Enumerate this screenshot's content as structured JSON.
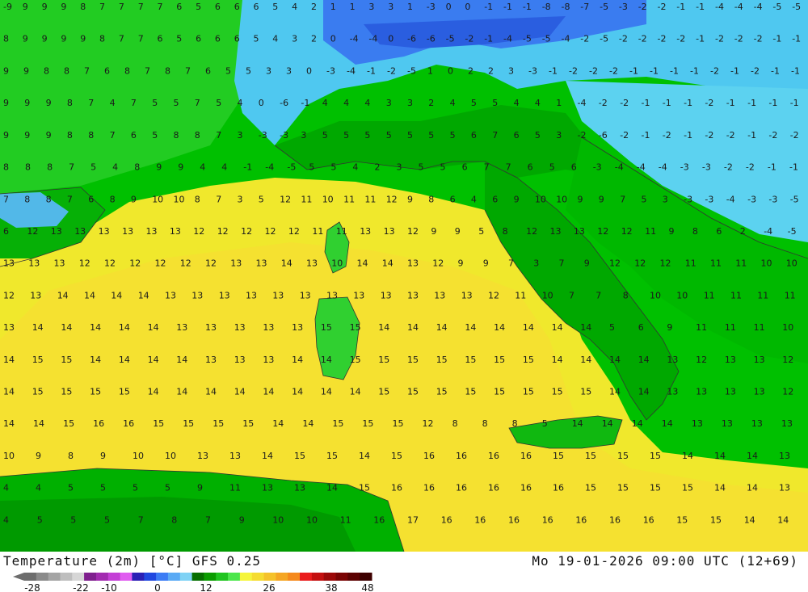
{
  "map": {
    "title": "Temperature (2m) [°C] GFS 0.25",
    "datetime": "Mo 19-01-2026 09:00 UTC (12+69)",
    "variable": "Temperature (2m)",
    "unit": "°C",
    "model": "GFS 0.25",
    "region": "Italy / Central Mediterranean",
    "value_rows": [
      [
        -9,
        9,
        9,
        9,
        8,
        7,
        7,
        7,
        7,
        6,
        5,
        6,
        6,
        6,
        5,
        4,
        2,
        1,
        1,
        3,
        3,
        1,
        -3,
        0,
        0,
        -1,
        -1,
        -1,
        -8,
        -8,
        -7,
        -5,
        -3,
        -2,
        -2,
        -1,
        -1,
        -4,
        -4,
        -4,
        -5,
        -5
      ],
      [
        8,
        9,
        9,
        9,
        9,
        8,
        7,
        7,
        6,
        5,
        6,
        6,
        6,
        5,
        4,
        3,
        2,
        0,
        -4,
        -4,
        0,
        -6,
        -6,
        -5,
        -2,
        -1,
        -4,
        -5,
        -5,
        -4,
        -2,
        -5,
        -2,
        -2,
        -2,
        -2,
        -1,
        -2,
        -2,
        -2,
        -1,
        -1
      ],
      [
        9,
        9,
        8,
        8,
        7,
        6,
        8,
        7,
        8,
        7,
        6,
        5,
        5,
        3,
        3,
        0,
        -3,
        -4,
        -1,
        -2,
        -5,
        1,
        0,
        2,
        2,
        3,
        -3,
        -1,
        -2,
        -2,
        -2,
        -1,
        -1,
        -1,
        -1,
        -2,
        -1,
        -2,
        -1,
        -1
      ],
      [
        9,
        9,
        9,
        8,
        7,
        4,
        7,
        5,
        5,
        7,
        5,
        4,
        0,
        -6,
        -1,
        4,
        4,
        4,
        3,
        3,
        2,
        4,
        5,
        5,
        4,
        4,
        1,
        -4,
        -2,
        -2,
        -1,
        -1,
        -1,
        -2,
        -1,
        -1,
        -1,
        -1
      ],
      [
        9,
        9,
        9,
        8,
        8,
        7,
        6,
        5,
        8,
        8,
        7,
        3,
        -3,
        -3,
        3,
        5,
        5,
        5,
        5,
        5,
        5,
        5,
        6,
        7,
        6,
        5,
        3,
        -2,
        -6,
        -2,
        -1,
        -2,
        -1,
        -2,
        -2,
        -1,
        -2,
        -2
      ],
      [
        8,
        8,
        8,
        7,
        5,
        4,
        8,
        9,
        9,
        4,
        4,
        -1,
        -4,
        -5,
        5,
        5,
        4,
        2,
        3,
        5,
        5,
        6,
        7,
        7,
        6,
        5,
        6,
        -3,
        -4,
        -4,
        -4,
        -3,
        -3,
        -2,
        -2,
        -1,
        -1
      ],
      [
        7,
        8,
        8,
        7,
        6,
        8,
        9,
        10,
        10,
        8,
        7,
        3,
        5,
        12,
        11,
        10,
        11,
        11,
        12,
        9,
        8,
        6,
        4,
        6,
        9,
        10,
        10,
        9,
        9,
        7,
        5,
        3,
        -3,
        -3,
        -4,
        -3,
        -3,
        -5
      ],
      [
        6,
        12,
        13,
        13,
        13,
        13,
        13,
        13,
        12,
        12,
        12,
        12,
        12,
        11,
        11,
        13,
        13,
        12,
        9,
        9,
        5,
        8,
        12,
        13,
        13,
        12,
        12,
        11,
        9,
        8,
        6,
        2,
        -4,
        -5
      ],
      [
        13,
        13,
        13,
        12,
        12,
        12,
        12,
        12,
        12,
        13,
        13,
        14,
        13,
        10,
        14,
        14,
        13,
        12,
        9,
        9,
        7,
        3,
        7,
        9,
        12,
        12,
        12,
        11,
        11,
        11,
        10,
        10
      ],
      [
        12,
        13,
        14,
        14,
        14,
        14,
        13,
        13,
        13,
        13,
        13,
        13,
        13,
        13,
        13,
        13,
        13,
        13,
        12,
        11,
        10,
        7,
        7,
        8,
        10,
        10,
        11,
        11,
        11,
        11
      ],
      [
        13,
        14,
        14,
        14,
        14,
        14,
        13,
        13,
        13,
        13,
        13,
        15,
        15,
        14,
        14,
        14,
        14,
        14,
        14,
        14,
        14,
        5,
        6,
        9,
        11,
        11,
        11,
        10
      ],
      [
        14,
        15,
        15,
        14,
        14,
        14,
        14,
        13,
        13,
        13,
        14,
        14,
        15,
        15,
        15,
        15,
        15,
        15,
        15,
        14,
        14,
        14,
        14,
        13,
        12,
        13,
        13,
        12
      ],
      [
        14,
        15,
        15,
        15,
        15,
        14,
        14,
        14,
        14,
        14,
        14,
        14,
        14,
        15,
        15,
        15,
        15,
        15,
        15,
        15,
        15,
        14,
        14,
        13,
        13,
        13,
        13,
        12
      ],
      [
        14,
        14,
        15,
        16,
        16,
        15,
        15,
        15,
        15,
        14,
        14,
        15,
        15,
        15,
        12,
        8,
        8,
        8,
        5,
        14,
        14,
        14,
        14,
        13,
        13,
        13,
        13
      ],
      [
        10,
        9,
        8,
        9,
        10,
        10,
        13,
        13,
        14,
        15,
        15,
        14,
        15,
        16,
        16,
        16,
        16,
        15,
        15,
        15,
        15,
        14,
        14,
        14,
        13
      ],
      [
        4,
        4,
        5,
        5,
        5,
        5,
        9,
        11,
        13,
        13,
        14,
        15,
        16,
        16,
        16,
        16,
        16,
        16,
        15,
        15,
        15,
        15,
        14,
        14,
        13
      ],
      [
        4,
        5,
        5,
        5,
        7,
        8,
        7,
        9,
        10,
        10,
        11,
        16,
        17,
        16,
        16,
        16,
        16,
        16,
        16,
        16,
        15,
        15,
        14,
        14
      ]
    ],
    "colorbar": {
      "ticks": [
        "-28",
        "-22",
        "-10",
        "0",
        "12",
        "26",
        "38",
        "48"
      ],
      "colors": [
        "#6d6d6d",
        "#8a8a8a",
        "#a4a4a4",
        "#bebebe",
        "#d6d6d6",
        "#7f1f8e",
        "#a22ab0",
        "#c43fd6",
        "#e05cf0",
        "#2a1fb5",
        "#1f47e0",
        "#3b7cf5",
        "#5aaaf5",
        "#7fd2f5",
        "#066e00",
        "#0a9c00",
        "#1fc41f",
        "#4ce64c",
        "#f5f53b",
        "#f5dc30",
        "#f5c22a",
        "#f5a623",
        "#f5891c",
        "#ea1c1c",
        "#c40f0f",
        "#9c0808",
        "#7a0404",
        "#5c0202",
        "#3d0000"
      ]
    }
  }
}
